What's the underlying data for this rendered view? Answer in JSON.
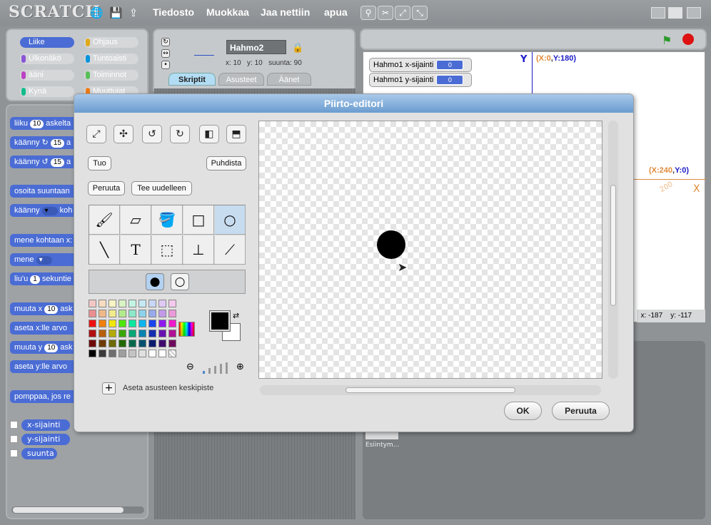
{
  "app": {
    "logo": "SCRATCH"
  },
  "menu": [
    "Tiedosto",
    "Muokkaa",
    "Jaa nettiin",
    "apua"
  ],
  "categories": [
    {
      "label": "Liike",
      "color": "#4a6cd4",
      "selected": true
    },
    {
      "label": "Ohjaus",
      "color": "#e1a91a"
    },
    {
      "label": "Ulkonäkö",
      "color": "#8a55d7"
    },
    {
      "label": "Tuntoaisti",
      "color": "#0094dd"
    },
    {
      "label": "ääni",
      "color": "#bb42c3"
    },
    {
      "label": "Toiminnot",
      "color": "#59c059"
    },
    {
      "label": "Kynä",
      "color": "#0fbd8c"
    },
    {
      "label": "Muuttujat",
      "color": "#ee7d16"
    }
  ],
  "blocks": {
    "move": {
      "pre": "liiku",
      "val": "10",
      "post": "askelta"
    },
    "turn_cw": {
      "pre": "käänny ↻",
      "val": "15",
      "post": "a"
    },
    "turn_ccw": {
      "pre": "käänny ↺",
      "val": "15",
      "post": "a"
    },
    "point_dir": "osoita suuntaan",
    "point_to": {
      "pre": "käänny",
      "post": "koh"
    },
    "goto_xy": "mene kohtaan x:",
    "goto": "mene",
    "glide": {
      "pre": "liu'u",
      "val": "1",
      "post": "sekuntie"
    },
    "change_x": {
      "pre": "muuta x",
      "val": "10",
      "post": "ask"
    },
    "set_x": "aseta x:lle arvo",
    "change_y": {
      "pre": "muuta y",
      "val": "10",
      "post": "ask"
    },
    "set_y": "aseta y:lle arvo",
    "bounce": "pomppaa, jos re",
    "reporters": [
      "x-sijainti",
      "y-sijainti",
      "suunta"
    ]
  },
  "sprite": {
    "name": "Hahmo2",
    "x_label": "x:",
    "x": "10",
    "y_label": "y:",
    "y": "10",
    "dir_label": "suunta:",
    "dir": "90"
  },
  "tabs": [
    "Skriptit",
    "Asusteet",
    "Äänet"
  ],
  "stage": {
    "monitors": [
      {
        "label": "Hahmo1 x-sijainti",
        "value": "0"
      },
      {
        "label": "Hahmo1 y-sijainti",
        "value": "0"
      }
    ],
    "y_axis": "Y",
    "y_coord": {
      "open": "(",
      "xk": "X:",
      "xv": "0",
      "sep": ",",
      "yk": "Y:",
      "yv": "180",
      "close": ")"
    },
    "x_axis": "X",
    "x_coord": {
      "open": "(",
      "xk": "X:",
      "xv": "240",
      "sep": ",",
      "yk": "Y:",
      "yv": "0",
      "close": ")"
    },
    "tick_200": "200",
    "mouse_x_label": "x:",
    "mouse_x": "-187",
    "mouse_y_label": "y:",
    "mouse_y": "-117",
    "thumb_label": "Esiintym..."
  },
  "editor": {
    "title": "Piirto-editori",
    "import": "Tuo",
    "clear": "Puhdista",
    "undo": "Peruuta",
    "redo": "Tee uudelleen",
    "center_label": "Aseta asusteen keskipiste",
    "ok": "OK",
    "cancel": "Peruuta",
    "selected_tool": "ellipse",
    "fill_mode": "filled",
    "fg_color": "#000000",
    "bg_color": "#ffffff",
    "palette": [
      [
        "#f4c7c7",
        "#f7dcc1",
        "#f8f4c4",
        "#d9f4c4",
        "#c4f4e4",
        "#c4e8f4",
        "#c9d6f4",
        "#e0c9f4",
        "#f4c9ec"
      ],
      [
        "#ea8f8f",
        "#f0b888",
        "#f2ea8c",
        "#b3ea8c",
        "#8ce8c8",
        "#8cd2ea",
        "#97aaea",
        "#c39aea",
        "#ea9ad8"
      ],
      [
        "#ee1111",
        "#f07f0d",
        "#f2e60d",
        "#4ee60d",
        "#0de6a0",
        "#0db4ee",
        "#1a44ee",
        "#8e1aee",
        "#ee1acc"
      ],
      [
        "#b01010",
        "#b75f09",
        "#b3aa08",
        "#3aa608",
        "#08a775",
        "#0884b0",
        "#132fb0",
        "#6712b0",
        "#b01295"
      ],
      [
        "#6e0909",
        "#6e3a06",
        "#6e6a05",
        "#246805",
        "#05684a",
        "#05506e",
        "#0b1c6e",
        "#400b6e",
        "#6e0b5c"
      ],
      [
        "#000000",
        "#3a3a3a",
        "#6e6e6e",
        "#9e9e9e",
        "#c4c4c4",
        "#e0e0e0",
        "#ffffff",
        "#ffffff",
        "checker"
      ]
    ]
  }
}
